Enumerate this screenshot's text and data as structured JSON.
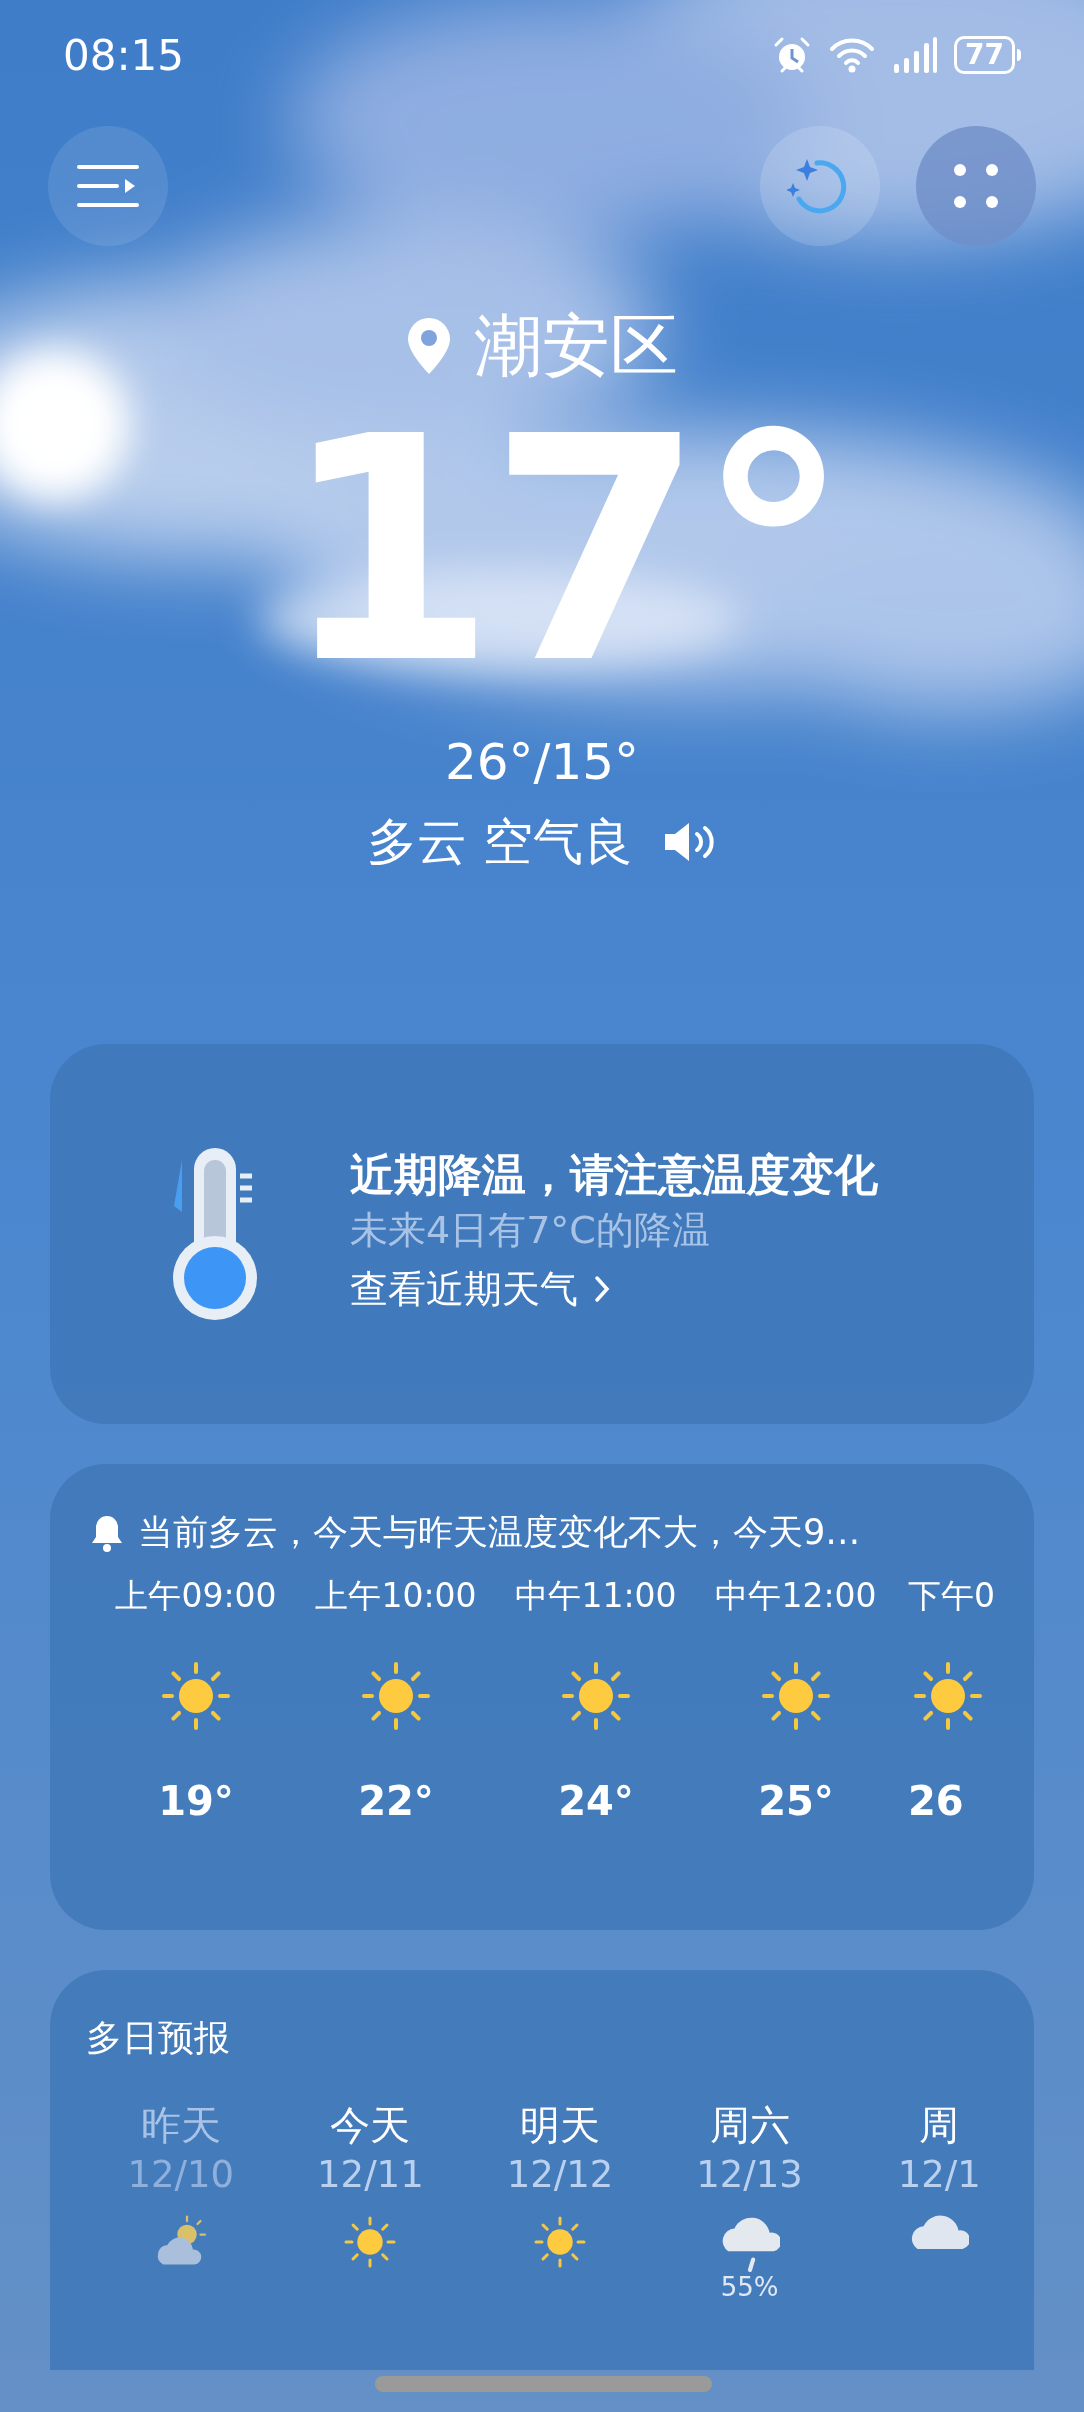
{
  "status_bar": {
    "time": "08:15",
    "battery": "77"
  },
  "header": {
    "location": "潮安区",
    "temperature": "17°",
    "high_low": "26°/15°",
    "condition": "多云 空气良"
  },
  "alert_card": {
    "title": "近期降温，请注意温度变化",
    "subtitle": "未来4日有7°C的降温",
    "link": "查看近期天气"
  },
  "hourly": {
    "summary": "当前多云，今天与昨天温度变化不大，今天9…",
    "items": [
      {
        "time": "上午09:00",
        "kind": "sunny",
        "temp": "19°"
      },
      {
        "time": "上午10:00",
        "kind": "sunny",
        "temp": "22°"
      },
      {
        "time": "中午11:00",
        "kind": "sunny",
        "temp": "24°"
      },
      {
        "time": "中午12:00",
        "kind": "sunny",
        "temp": "25°"
      },
      {
        "time": "下午0",
        "kind": "sunny",
        "temp": "26"
      }
    ]
  },
  "daily": {
    "title": "多日预报",
    "items": [
      {
        "day": "昨天",
        "date": "12/10",
        "past": true,
        "kind": "partly_cloudy"
      },
      {
        "day": "今天",
        "date": "12/11",
        "past": false,
        "kind": "sunny"
      },
      {
        "day": "明天",
        "date": "12/12",
        "past": false,
        "kind": "sunny"
      },
      {
        "day": "周六",
        "date": "12/13",
        "past": false,
        "kind": "rain",
        "precip": "55%"
      },
      {
        "day": "周",
        "date": "12/1",
        "past": false,
        "kind": "cloudy"
      }
    ]
  }
}
